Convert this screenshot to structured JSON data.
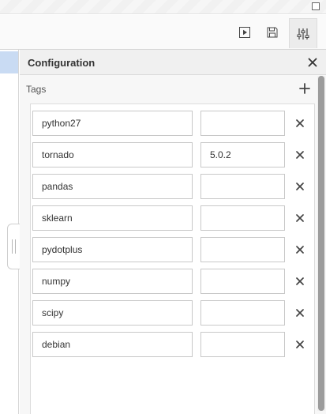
{
  "toolbar": {
    "buttons": [
      {
        "icon": "play-icon"
      },
      {
        "icon": "save-icon"
      },
      {
        "icon": "sliders-icon"
      }
    ]
  },
  "panel": {
    "title": "Configuration",
    "tags_label": "Tags",
    "tags": [
      {
        "name": "python27",
        "version": ""
      },
      {
        "name": "tornado",
        "version": "5.0.2"
      },
      {
        "name": "pandas",
        "version": ""
      },
      {
        "name": "sklearn",
        "version": ""
      },
      {
        "name": "pydotplus",
        "version": ""
      },
      {
        "name": "numpy",
        "version": ""
      },
      {
        "name": "scipy",
        "version": ""
      },
      {
        "name": "debian",
        "version": ""
      }
    ]
  },
  "colors": {
    "selection": "#c9dbf3",
    "icon": "#444444",
    "scroll_thumb": "#9c9c9c"
  }
}
